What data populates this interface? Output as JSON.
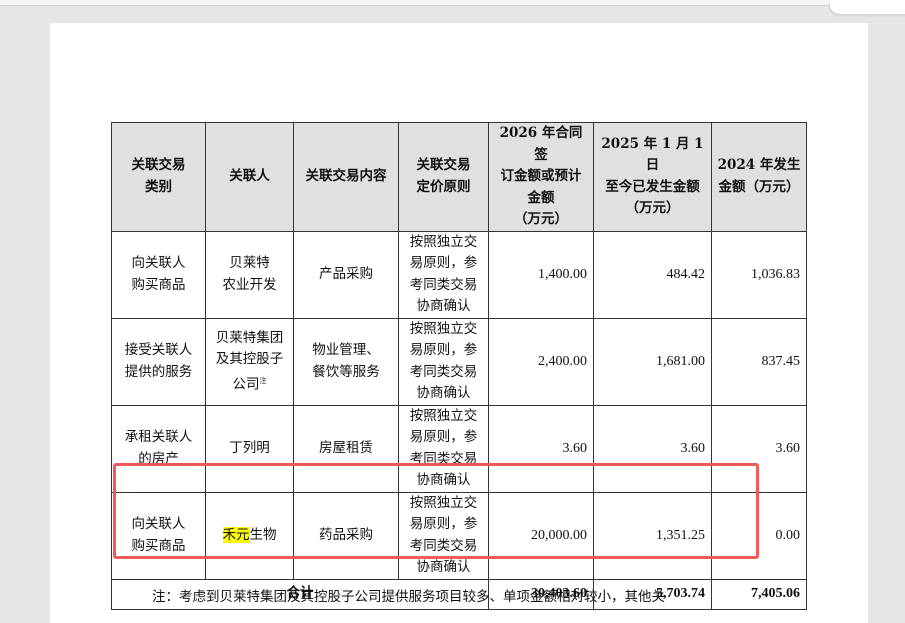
{
  "table": {
    "headers": [
      "关联交易类别",
      "关联人",
      "关联交易内容",
      "关联交易定价原则",
      "2026 年合同签订金额或预计金额（万元）",
      "2025 年 1 月 1 日至今已发生金额（万元）",
      "2024 年发生金额（万元）"
    ],
    "header_lines": [
      [
        "关联交易",
        "类别"
      ],
      [
        "关联人"
      ],
      [
        "关联交易内容"
      ],
      [
        "关联交易",
        "定价原则"
      ],
      [
        "2026 年合同签",
        "订金额或预计",
        "金额",
        "（万元）"
      ],
      [
        "2025 年 1 月 1 日",
        "至今已发生金额",
        "（万元）"
      ],
      [
        "2024 年发生",
        "金额（万元）"
      ]
    ],
    "rows": [
      {
        "category": [
          "向关联人",
          "购买商品"
        ],
        "party": [
          "贝莱特",
          "农业开发"
        ],
        "content": [
          "产品采购"
        ],
        "principle": [
          "按照独立交",
          "易原则，参",
          "考同类交易",
          "协商确认"
        ],
        "amount_2026": "1,400.00",
        "amount_2025": "484.42",
        "amount_2024": "1,036.83"
      },
      {
        "category": [
          "接受关联人",
          "提供的服务"
        ],
        "party": [
          "贝莱特集团",
          "及其控股子",
          "公司"
        ],
        "party_note": "注",
        "content": [
          "物业管理、",
          "餐饮等服务"
        ],
        "principle": [
          "按照独立交",
          "易原则，参",
          "考同类交易",
          "协商确认"
        ],
        "amount_2026": "2,400.00",
        "amount_2025": "1,681.00",
        "amount_2024": "837.45"
      },
      {
        "category": [
          "承租关联人",
          "的房产"
        ],
        "party": [
          "丁列明"
        ],
        "content": [
          "房屋租赁"
        ],
        "principle": [
          "按照独立交",
          "易原则，参",
          "考同类交易",
          "协商确认"
        ],
        "amount_2026": "3.60",
        "amount_2025": "3.60",
        "amount_2024": "3.60"
      },
      {
        "category": [
          "向关联人",
          "购买商品"
        ],
        "party_highlight": "禾元",
        "party_rest": "生物",
        "content": [
          "药品采购"
        ],
        "principle": [
          "按照独立交",
          "易原则，参",
          "考同类交易",
          "协商确认"
        ],
        "amount_2026": "20,000.00",
        "amount_2025": "1,351.25",
        "amount_2024": "0.00"
      }
    ],
    "total": {
      "label": "合计",
      "amount_2026": "30,403.60",
      "amount_2025": "5,703.74",
      "amount_2024": "7,405.06"
    }
  },
  "note": "注：考虑到贝莱特集团及其控股子公司提供服务项目较多、单项金额相对较小，其他关",
  "colors": {
    "highlight": "#ffff00",
    "annotation_box": "#f05a5a",
    "header_bg": "#e0e0e0"
  }
}
